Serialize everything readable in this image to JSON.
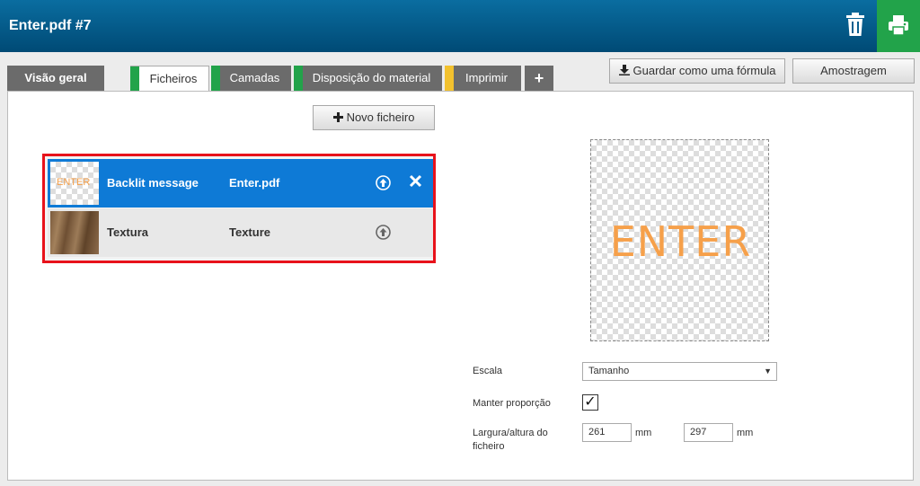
{
  "header": {
    "title": "Enter.pdf #7"
  },
  "tabs": [
    {
      "label": "Visão geral"
    },
    {
      "label": "Ficheiros",
      "stripe": "#22a34a"
    },
    {
      "label": "Camadas",
      "stripe": "#22a34a"
    },
    {
      "label": "Disposição do material",
      "stripe": "#22a34a"
    },
    {
      "label": "Imprimir",
      "stripe": "#f2c12e"
    },
    {
      "label": "+"
    }
  ],
  "toolbar": {
    "save_formula_label": "Guardar como uma fórmula",
    "sampling_label": "Amostragem",
    "new_file_label": "Novo ficheiro"
  },
  "files": [
    {
      "thumb_text": "ENTER",
      "name": "Backlit message",
      "file": "Enter.pdf"
    },
    {
      "name": "Textura",
      "file": "Texture"
    }
  ],
  "preview": {
    "text": "ENTER"
  },
  "form": {
    "scale_label": "Escala",
    "scale_value": "Tamanho",
    "keep_ratio_label": "Manter proporção",
    "keep_ratio_checked": "✓",
    "size_label_1": "Largura/altura do",
    "size_label_2": "ficheiro",
    "width": "261",
    "height": "297",
    "unit": "mm"
  },
  "colors": {
    "header": "#005a8a",
    "selected_row": "#0e7ad6",
    "print": "#22a34a",
    "highlight": "#e8121b"
  }
}
